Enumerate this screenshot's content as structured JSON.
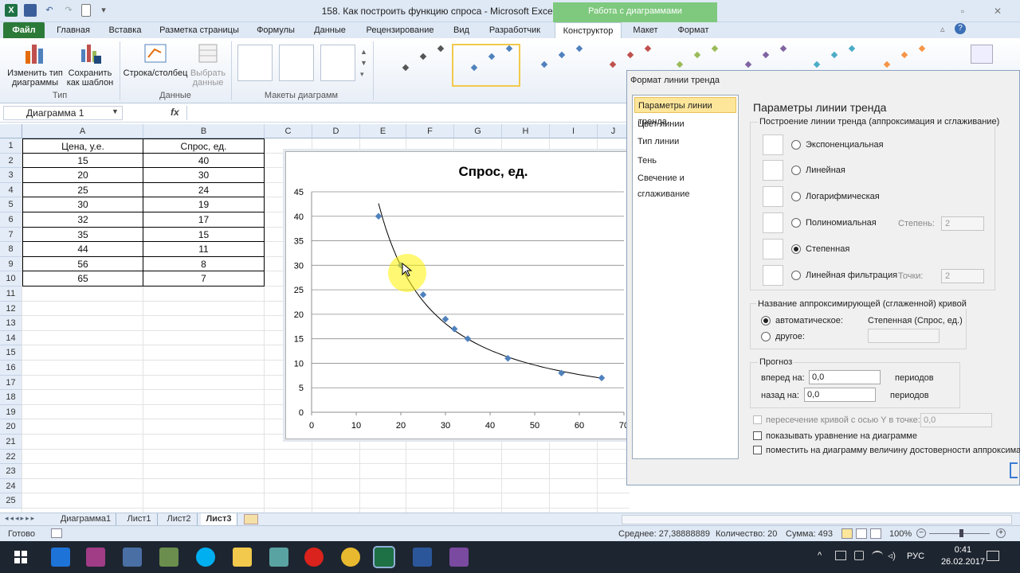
{
  "window": {
    "title": "158. Как построить функцию спроса - Microsoft Excel",
    "context_tab_header": "Работа с диаграммами"
  },
  "ribbon_tabs": [
    "Файл",
    "Главная",
    "Вставка",
    "Разметка страницы",
    "Формулы",
    "Данные",
    "Рецензирование",
    "Вид",
    "Разработчик",
    "Конструктор",
    "Макет",
    "Формат"
  ],
  "ribbon": {
    "change_type_label": "Изменить тип диаграммы",
    "save_template_label": "Сохранить как шаблон",
    "group_type": "Тип",
    "row_col_label": "Строка/столбец",
    "select_data_label": "Выбрать данные",
    "group_data": "Данные",
    "group_layouts": "Макеты диаграмм"
  },
  "formula_bar": {
    "name_box": "Диаграмма 1",
    "fx": "fx"
  },
  "columns": [
    "A",
    "B",
    "C",
    "D",
    "E",
    "F",
    "G",
    "H",
    "I",
    "J"
  ],
  "rows": [
    "1",
    "2",
    "3",
    "4",
    "5",
    "6",
    "7",
    "8",
    "9",
    "10",
    "11",
    "12",
    "13",
    "14",
    "15",
    "16",
    "17",
    "18",
    "19",
    "20",
    "21",
    "22",
    "23",
    "24",
    "25"
  ],
  "table": {
    "headers": [
      "Цена, у.е.",
      "Спрос, ед."
    ],
    "rows": [
      [
        "15",
        "40"
      ],
      [
        "20",
        "30"
      ],
      [
        "25",
        "24"
      ],
      [
        "30",
        "19"
      ],
      [
        "32",
        "17"
      ],
      [
        "35",
        "15"
      ],
      [
        "44",
        "11"
      ],
      [
        "56",
        "8"
      ],
      [
        "65",
        "7"
      ]
    ]
  },
  "chart_data": {
    "type": "scatter",
    "title": "Спрос, ед.",
    "x": [
      15,
      20,
      25,
      30,
      32,
      35,
      44,
      56,
      65
    ],
    "y": [
      40,
      30,
      24,
      19,
      17,
      15,
      11,
      8,
      7
    ],
    "xlim": [
      0,
      70
    ],
    "ylim": [
      0,
      45
    ],
    "xticks": [
      "0",
      "10",
      "20",
      "30",
      "40",
      "50",
      "60",
      "70"
    ],
    "yticks": [
      "0",
      "5",
      "10",
      "15",
      "20",
      "25",
      "30",
      "35",
      "40",
      "45"
    ],
    "trendline": "power",
    "grid": true,
    "marker_color": "#4f81bd"
  },
  "dialog": {
    "title": "Формат линии тренда",
    "nav": [
      "Параметры линии тренда",
      "Цвет линии",
      "Тип линии",
      "Тень",
      "Свечение и сглаживание"
    ],
    "heading": "Параметры линии тренда",
    "section_build": "Построение линии тренда (аппроксимация и сглаживание)",
    "types": [
      "Экспоненциальная",
      "Линейная",
      "Логарифмическая",
      "Полиномиальная",
      "Степенная",
      "Линейная фильтрация"
    ],
    "selected_type": "Степенная",
    "degree_label": "Степень:",
    "degree_value": "2",
    "points_label": "Точки:",
    "points_value": "2",
    "section_name": "Название аппроксимирующей (сглаженной) кривой",
    "name_auto": "автоматическое:",
    "name_auto_value": "Степенная (Спрос, ед.)",
    "name_other": "другое:",
    "section_forecast": "Прогноз",
    "forward_label": "вперед на:",
    "forward_value": "0,0",
    "back_label": "назад на:",
    "back_value": "0,0",
    "periods": "периодов",
    "intercept_label": "пересечение кривой с осью Y в точке:",
    "intercept_value": "0,0",
    "show_equation": "показывать уравнение на диаграмме",
    "show_r2": "поместить на диаграмму величину достоверности аппроксимации"
  },
  "sheets": [
    "Диаграмма1",
    "Лист1",
    "Лист2",
    "Лист3"
  ],
  "active_sheet": "Лист3",
  "status": {
    "ready": "Готово",
    "average": "Среднее: 27,38888889",
    "count": "Количество: 20",
    "sum": "Сумма: 493",
    "zoom": "100%"
  },
  "taskbar": {
    "lang": "РУС",
    "time": "0:41",
    "date": "26.02.2017"
  }
}
